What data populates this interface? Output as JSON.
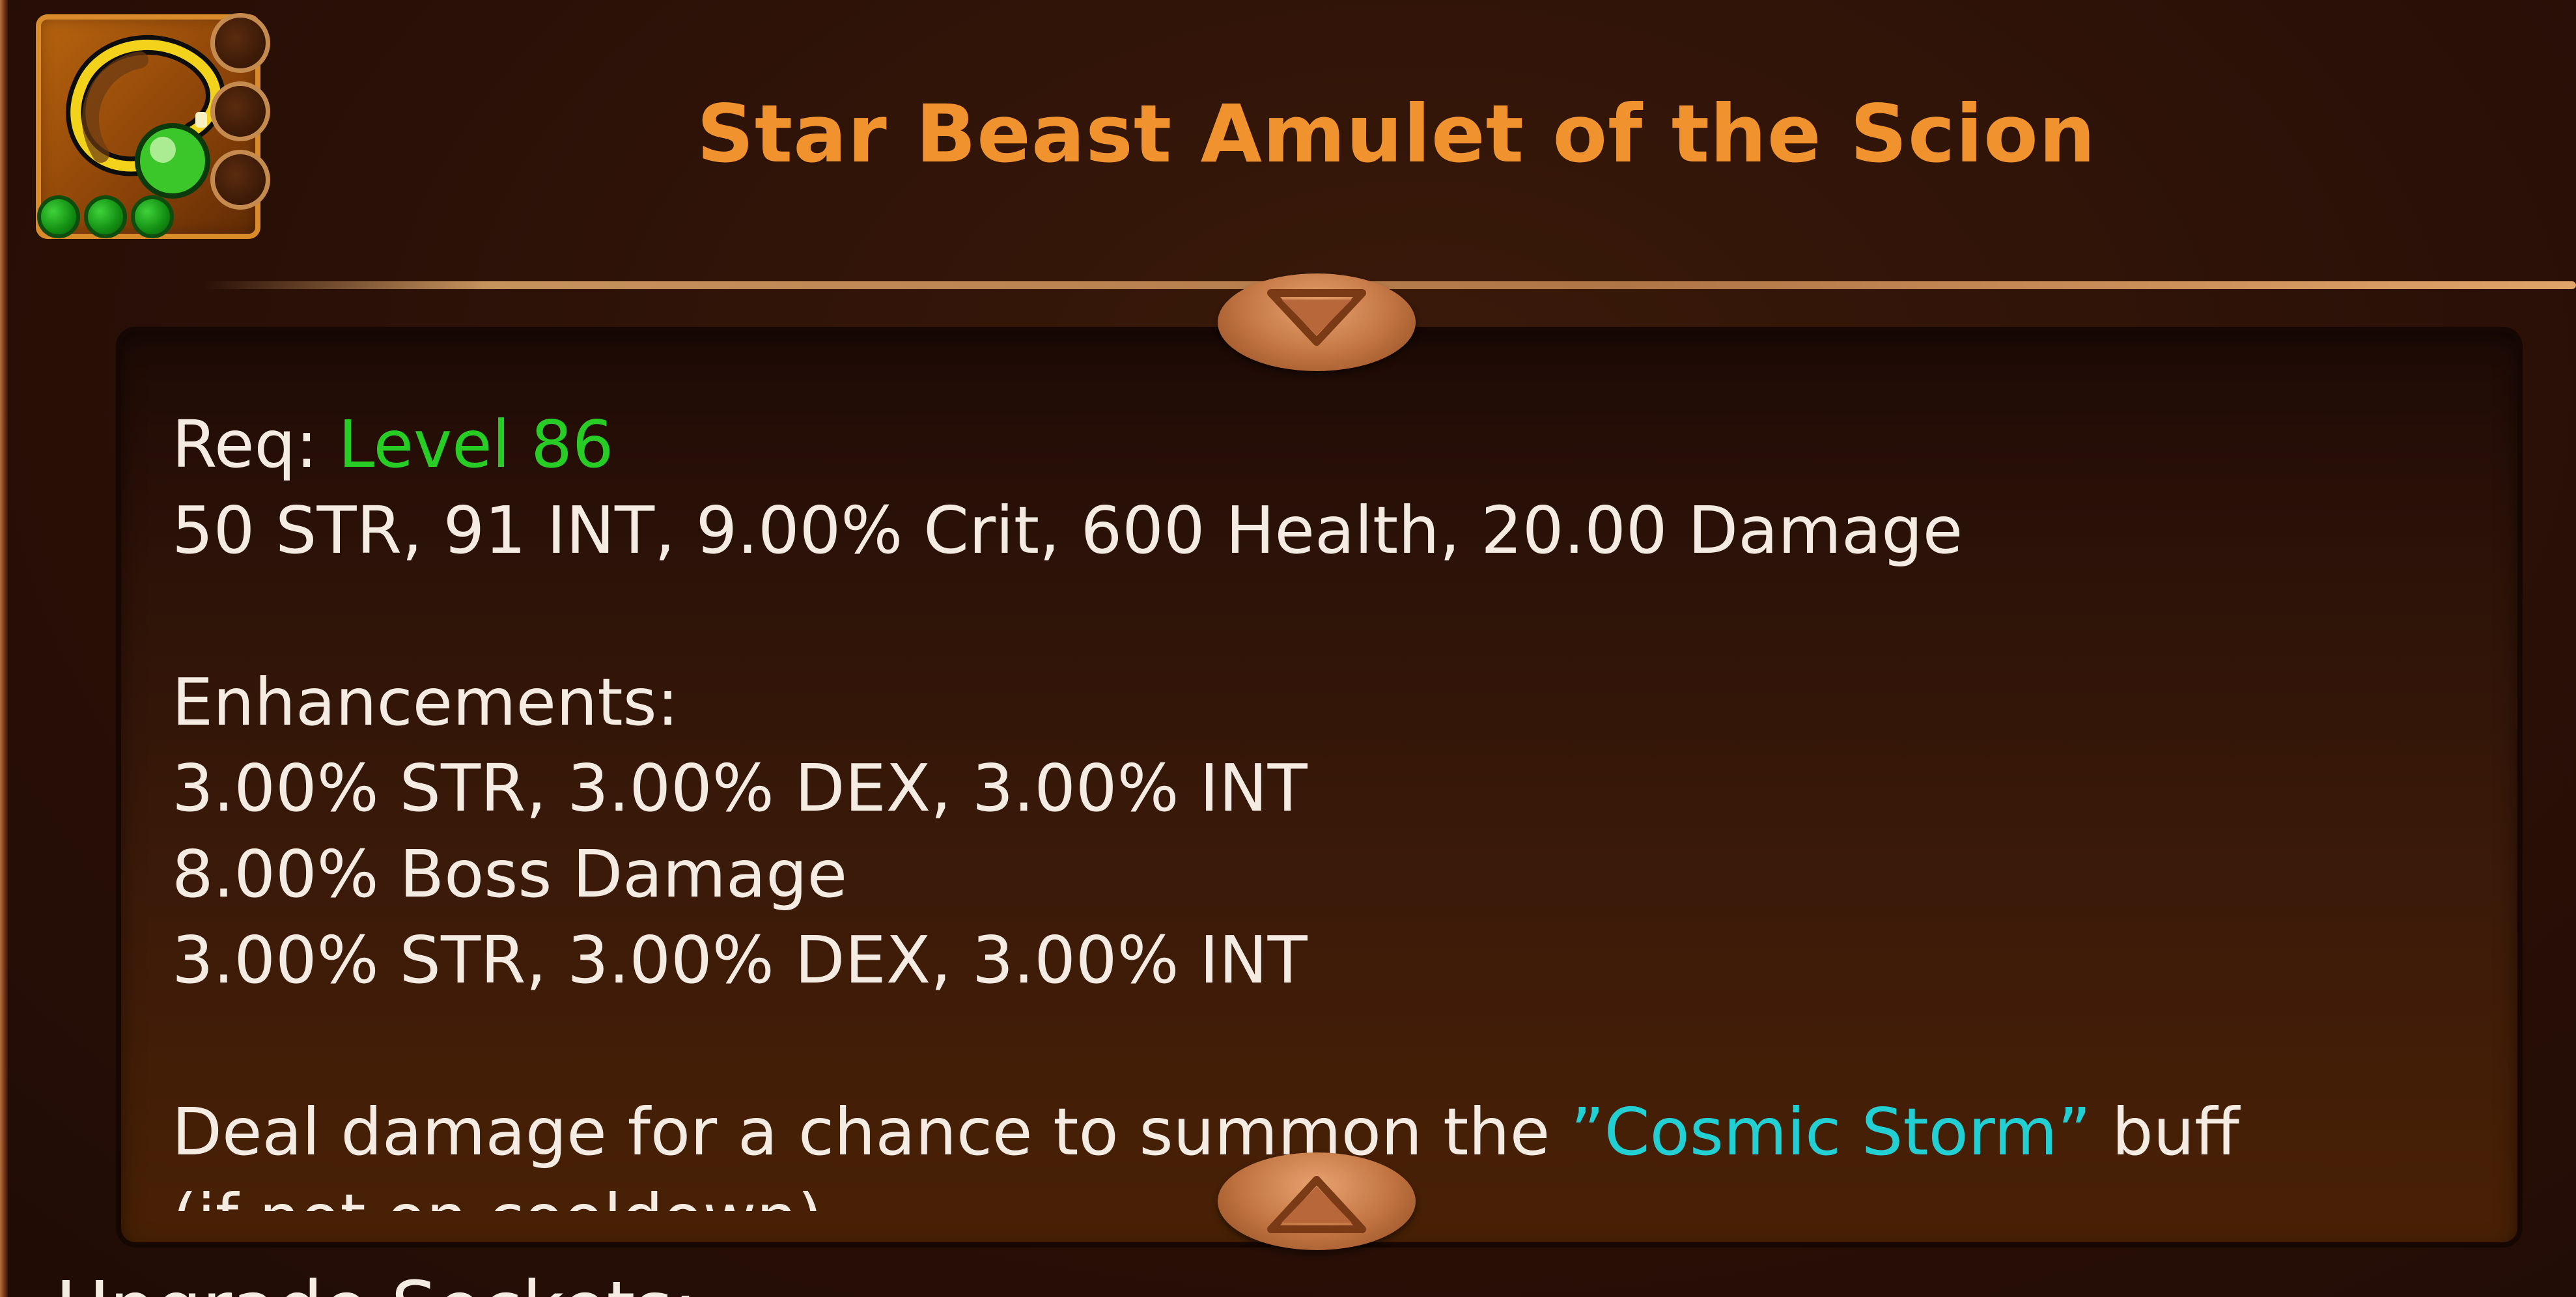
{
  "item": {
    "name": "Star Beast Amulet of the Scion",
    "icon": "amulet-icon",
    "filled_gems": 3,
    "empty_sockets": 3,
    "gem_color": "#1fae1f"
  },
  "description": {
    "req_label": "Req:",
    "req_value": "Level 86",
    "base_stats": "50 STR, 91 INT, 9.00% Crit, 600 Health, 20.00 Damage",
    "enhancements_heading": "Enhancements:",
    "enhancements": [
      "3.00% STR, 3.00% DEX, 3.00% INT",
      "8.00% Boss Damage",
      "3.00% STR, 3.00% DEX, 3.00% INT"
    ],
    "effect_prefix": "Deal damage for a chance to summon the ",
    "effect_buff": "”Cosmic Storm”",
    "effect_suffix": " buff",
    "effect_next_line": "(if not on cooldown)"
  },
  "upgrade_sockets_heading": "Upgrade Sockets:",
  "colors": {
    "title": "#f0932e",
    "level": "#27cc24",
    "buff": "#22d0d4",
    "text": "#f4ece2"
  }
}
